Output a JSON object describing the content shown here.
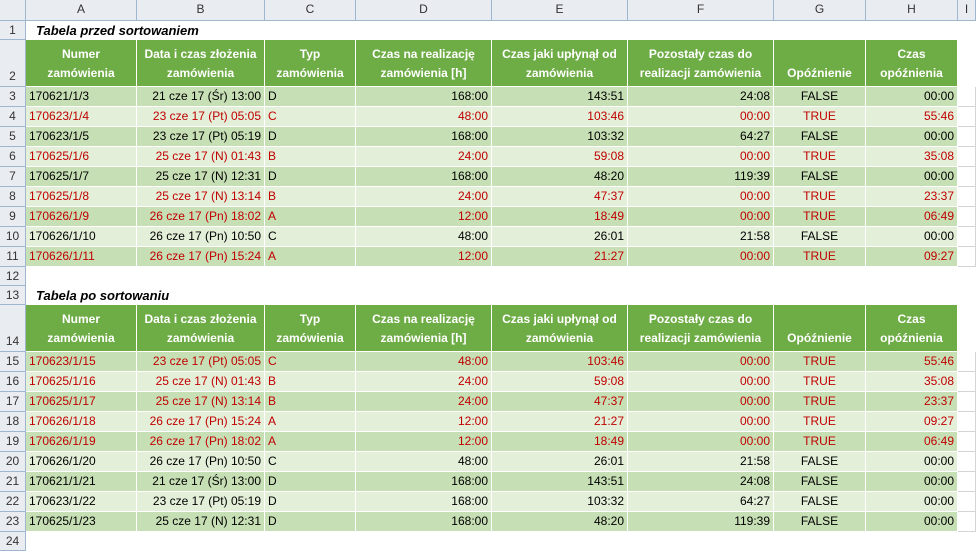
{
  "columns": [
    "A",
    "B",
    "C",
    "D",
    "E",
    "F",
    "G",
    "H",
    "I"
  ],
  "table1_title": "Tabela przed sortowaniem",
  "table2_title": "Tabela po sortowaniu",
  "headers": {
    "col_a": "Numer zamówienia",
    "col_b": "Data i czas złożenia zamówienia",
    "col_c": "Typ zamówienia",
    "col_d": "Czas na realizację zamówienia [h]",
    "col_e": "Czas jaki upłynął od zamówienia",
    "col_f": "Pozostały czas do realizacji zamówienia",
    "col_g": "Opóźnienie",
    "col_h": "Czas opóźnienia"
  },
  "table1_rows": [
    {
      "rownum": "3",
      "a": "170621/1/3",
      "b": "21 cze 17 (Śr) 13:00",
      "c": "D",
      "d": "168:00",
      "e": "143:51",
      "f": "24:08",
      "g": "FALSE",
      "h": "00:00",
      "late": false
    },
    {
      "rownum": "4",
      "a": "170623/1/4",
      "b": "23 cze 17 (Pt) 05:05",
      "c": "C",
      "d": "48:00",
      "e": "103:46",
      "f": "00:00",
      "g": "TRUE",
      "h": "55:46",
      "late": true
    },
    {
      "rownum": "5",
      "a": "170623/1/5",
      "b": "23 cze 17 (Pt) 05:19",
      "c": "D",
      "d": "168:00",
      "e": "103:32",
      "f": "64:27",
      "g": "FALSE",
      "h": "00:00",
      "late": false
    },
    {
      "rownum": "6",
      "a": "170625/1/6",
      "b": "25 cze 17 (N) 01:43",
      "c": "B",
      "d": "24:00",
      "e": "59:08",
      "f": "00:00",
      "g": "TRUE",
      "h": "35:08",
      "late": true
    },
    {
      "rownum": "7",
      "a": "170625/1/7",
      "b": "25 cze 17 (N) 12:31",
      "c": "D",
      "d": "168:00",
      "e": "48:20",
      "f": "119:39",
      "g": "FALSE",
      "h": "00:00",
      "late": false
    },
    {
      "rownum": "8",
      "a": "170625/1/8",
      "b": "25 cze 17 (N) 13:14",
      "c": "B",
      "d": "24:00",
      "e": "47:37",
      "f": "00:00",
      "g": "TRUE",
      "h": "23:37",
      "late": true
    },
    {
      "rownum": "9",
      "a": "170626/1/9",
      "b": "26 cze 17 (Pn) 18:02",
      "c": "A",
      "d": "12:00",
      "e": "18:49",
      "f": "00:00",
      "g": "TRUE",
      "h": "06:49",
      "late": true
    },
    {
      "rownum": "10",
      "a": "170626/1/10",
      "b": "26 cze 17 (Pn) 10:50",
      "c": "C",
      "d": "48:00",
      "e": "26:01",
      "f": "21:58",
      "g": "FALSE",
      "h": "00:00",
      "late": false
    },
    {
      "rownum": "11",
      "a": "170626/1/11",
      "b": "26 cze 17 (Pn) 15:24",
      "c": "A",
      "d": "12:00",
      "e": "21:27",
      "f": "00:00",
      "g": "TRUE",
      "h": "09:27",
      "late": true
    }
  ],
  "table2_rows": [
    {
      "rownum": "15",
      "a": "170623/1/15",
      "b": "23 cze 17 (Pt) 05:05",
      "c": "C",
      "d": "48:00",
      "e": "103:46",
      "f": "00:00",
      "g": "TRUE",
      "h": "55:46",
      "late": true
    },
    {
      "rownum": "16",
      "a": "170625/1/16",
      "b": "25 cze 17 (N) 01:43",
      "c": "B",
      "d": "24:00",
      "e": "59:08",
      "f": "00:00",
      "g": "TRUE",
      "h": "35:08",
      "late": true
    },
    {
      "rownum": "17",
      "a": "170625/1/17",
      "b": "25 cze 17 (N) 13:14",
      "c": "B",
      "d": "24:00",
      "e": "47:37",
      "f": "00:00",
      "g": "TRUE",
      "h": "23:37",
      "late": true
    },
    {
      "rownum": "18",
      "a": "170626/1/18",
      "b": "26 cze 17 (Pn) 15:24",
      "c": "A",
      "d": "12:00",
      "e": "21:27",
      "f": "00:00",
      "g": "TRUE",
      "h": "09:27",
      "late": true
    },
    {
      "rownum": "19",
      "a": "170626/1/19",
      "b": "26 cze 17 (Pn) 18:02",
      "c": "A",
      "d": "12:00",
      "e": "18:49",
      "f": "00:00",
      "g": "TRUE",
      "h": "06:49",
      "late": true
    },
    {
      "rownum": "20",
      "a": "170626/1/20",
      "b": "26 cze 17 (Pn) 10:50",
      "c": "C",
      "d": "48:00",
      "e": "26:01",
      "f": "21:58",
      "g": "FALSE",
      "h": "00:00",
      "late": false
    },
    {
      "rownum": "21",
      "a": "170621/1/21",
      "b": "21 cze 17 (Śr) 13:00",
      "c": "D",
      "d": "168:00",
      "e": "143:51",
      "f": "24:08",
      "g": "FALSE",
      "h": "00:00",
      "late": false
    },
    {
      "rownum": "22",
      "a": "170623/1/22",
      "b": "23 cze 17 (Pt) 05:19",
      "c": "D",
      "d": "168:00",
      "e": "103:32",
      "f": "64:27",
      "g": "FALSE",
      "h": "00:00",
      "late": false
    },
    {
      "rownum": "23",
      "a": "170625/1/23",
      "b": "25 cze 17 (N) 12:31",
      "c": "D",
      "d": "168:00",
      "e": "48:20",
      "f": "119:39",
      "g": "FALSE",
      "h": "00:00",
      "late": false
    }
  ],
  "row_labels": {
    "r1": "1",
    "r2": "2",
    "r12": "12",
    "r13": "13",
    "r14": "14",
    "r24": "24"
  },
  "colors": {
    "header_green": "#6eac46",
    "row_dark": "#c7dfb5",
    "row_light": "#e3efd9",
    "late_red": "#c00000"
  }
}
